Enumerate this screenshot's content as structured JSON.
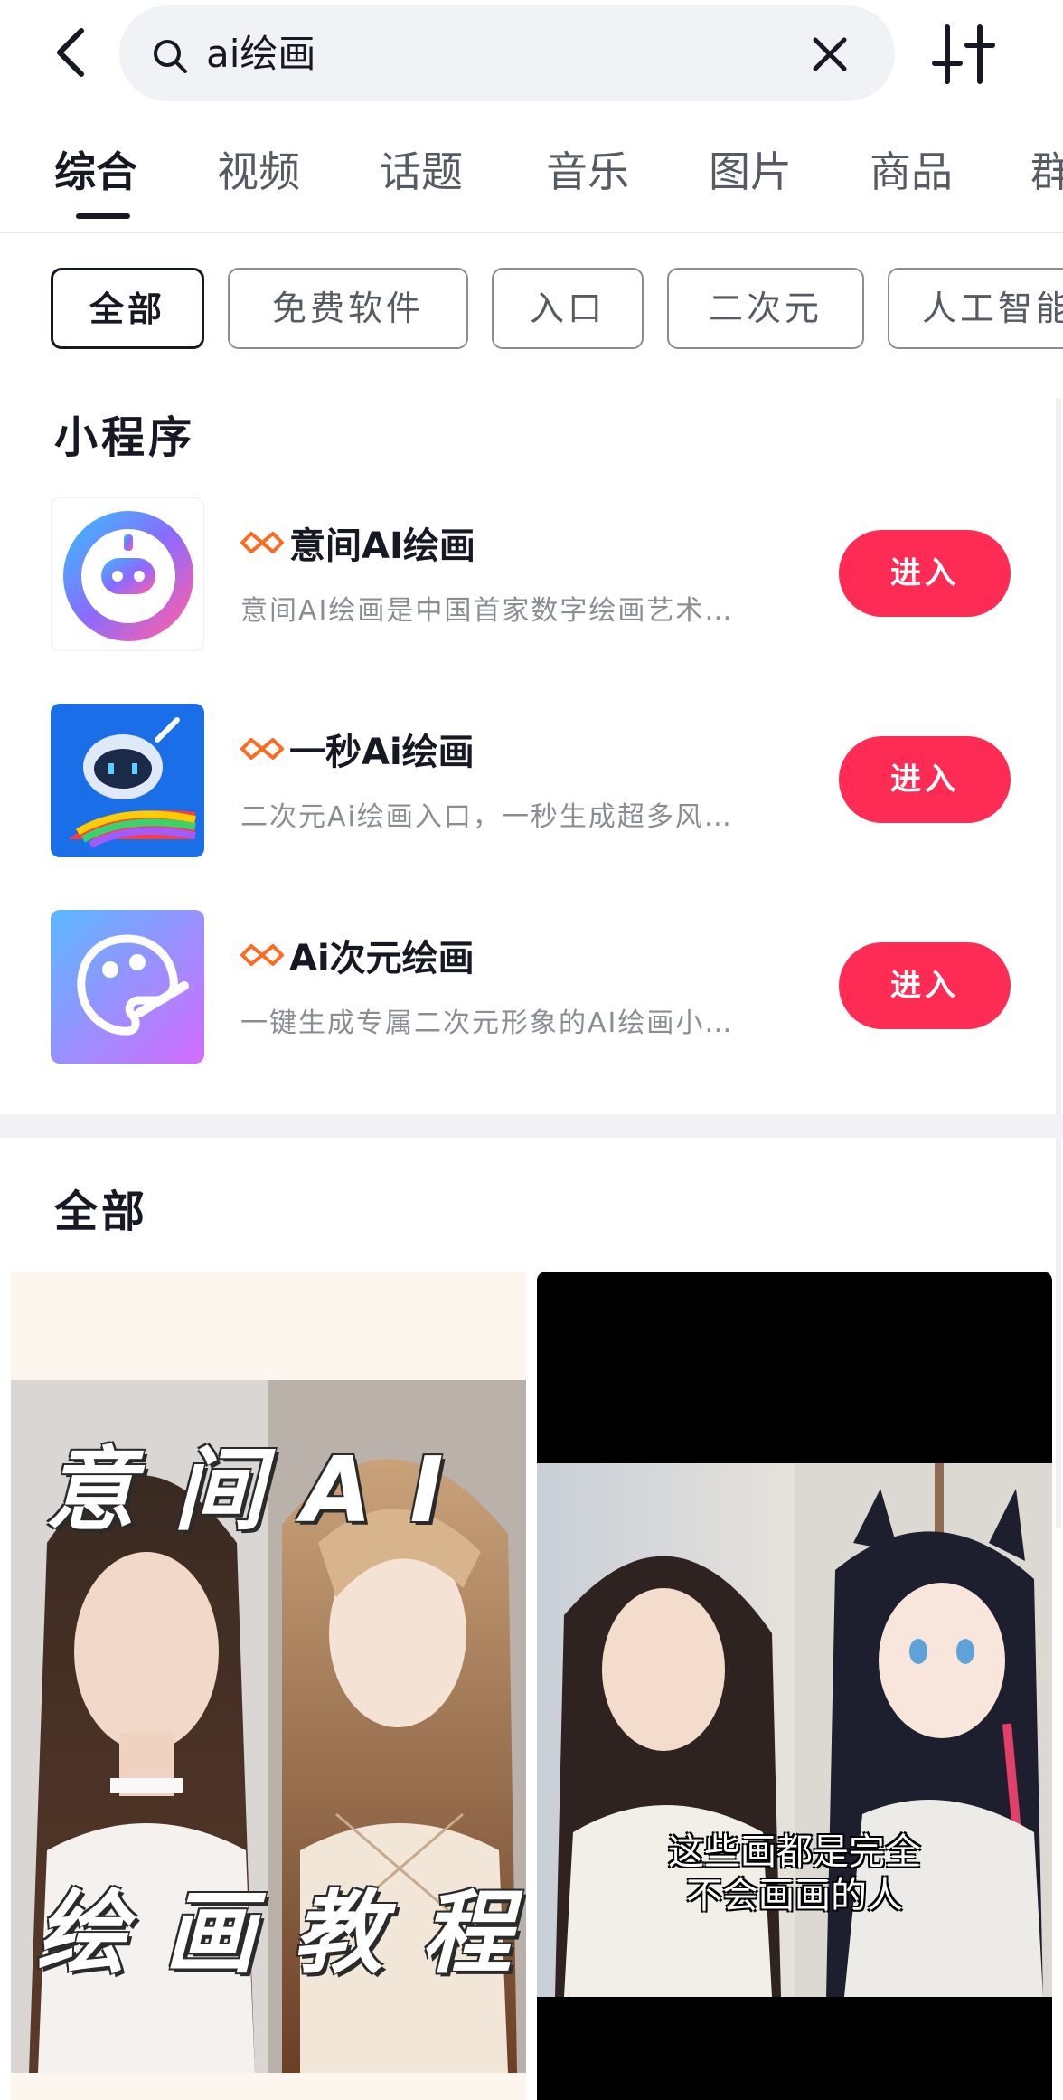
{
  "search": {
    "query": "ai绘画"
  },
  "tabs": [
    "综合",
    "视频",
    "话题",
    "音乐",
    "图片",
    "商品",
    "群"
  ],
  "chips": [
    "全部",
    "免费软件",
    "入口",
    "二次元",
    "人工智能"
  ],
  "mini_programs": {
    "title": "小程序",
    "items": [
      {
        "name": "意间AI绘画",
        "desc": "意间AI绘画是中国首家数字绘画艺术…",
        "button": "进入"
      },
      {
        "name": "一秒Ai绘画",
        "desc": "二次元Ai绘画入口，一秒生成超多风…",
        "button": "进入"
      },
      {
        "name": "Ai次元绘画",
        "desc": "一键生成专属二次元形象的AI绘画小…",
        "button": "进入"
      }
    ]
  },
  "all_section": {
    "title": "全部"
  },
  "videos": [
    {
      "overlay_top": "意间AI",
      "overlay_bottom": "绘画教程"
    },
    {
      "caption_line1": "这些画都是完全",
      "caption_line2": "不会画画的人"
    }
  ],
  "colors": {
    "accent": "#fe2c55",
    "mini_program_badge": "#ff6a1f",
    "search_bg": "#f1f2f5"
  }
}
